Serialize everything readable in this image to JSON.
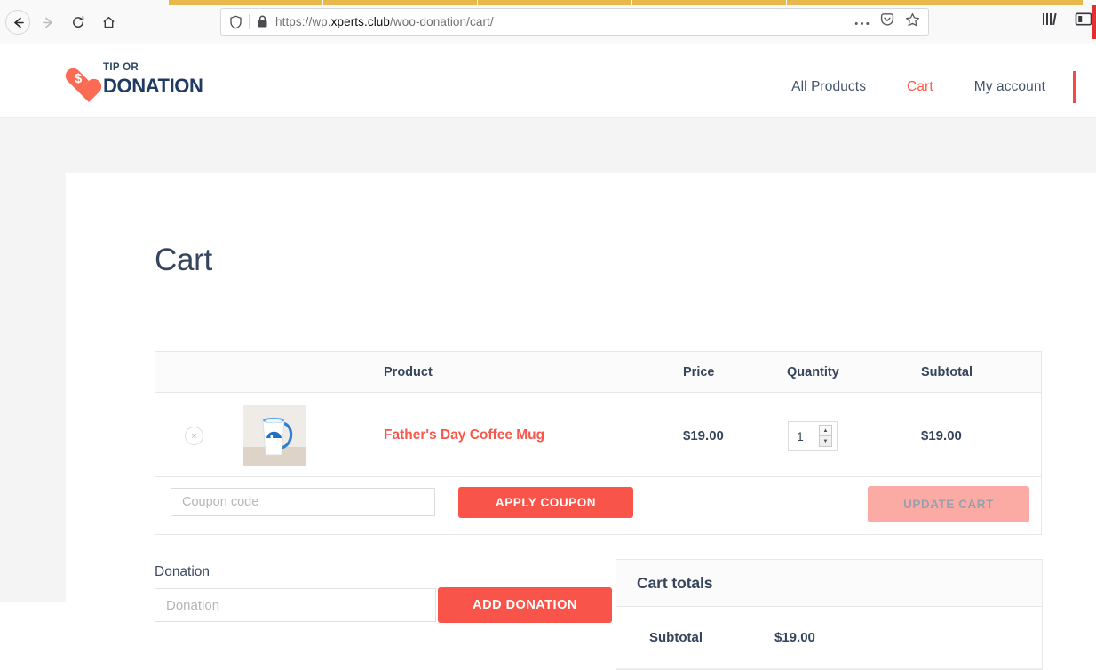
{
  "browser": {
    "tabs": [
      {
        "name": "tab-1"
      },
      {
        "name": "tab-2"
      },
      {
        "name": "tab-3"
      },
      {
        "name": "tab-4"
      },
      {
        "name": "tab-5"
      },
      {
        "name": "tab-6"
      }
    ],
    "back_icon": "back-arrow-icon",
    "forward_icon": "forward-arrow-icon",
    "reload_icon": "reload-icon",
    "home_icon": "home-icon",
    "shield_icon": "shield-icon",
    "lock_icon": "padlock-icon",
    "page_actions_icon": "ellipsis-icon",
    "pocket_icon": "pocket-save-icon",
    "bookmark_icon": "star-bookmark-icon",
    "library_icon": "library-icon",
    "sidebar_icon": "sidebar-toggle-icon",
    "url_prefix": "https://wp.",
    "url_domain": "xperts.club",
    "url_path": "/woo-donation/cart/",
    "url_full": "https://wp.xperts.club/woo-donation/cart/"
  },
  "site": {
    "logo": {
      "mark_symbol": "$",
      "tagline": "TIP OR",
      "name": "DONATION",
      "heart_color": "#fb6a52",
      "text_color": "#1f3a63"
    },
    "nav": {
      "items": [
        {
          "label": "All Products",
          "active": false
        },
        {
          "label": "Cart",
          "active": true
        },
        {
          "label": "My account",
          "active": false
        }
      ],
      "accent_color": "#f44a45"
    }
  },
  "page": {
    "title": "Cart"
  },
  "cart_table": {
    "headers": {
      "product": "Product",
      "price": "Price",
      "quantity": "Quantity",
      "subtotal": "Subtotal"
    },
    "rows": [
      {
        "remove_label": "×",
        "thumbnail": "coffee-mug-photo",
        "product_name": "Father's Day Coffee Mug",
        "price": "$19.00",
        "quantity": "1",
        "subtotal": "$19.00",
        "name_color": "#f9574b"
      }
    ],
    "coupon": {
      "placeholder": "Coupon code",
      "value": "",
      "apply_label": "APPLY COUPON",
      "apply_color": "#f9544a",
      "update_label": "UPDATE CART",
      "update_color": "#fbaba4",
      "update_text_color": "#9aa0ab",
      "update_disabled": true
    }
  },
  "donation": {
    "label": "Donation",
    "placeholder": "Donation",
    "value": "",
    "button_label": "ADD DONATION",
    "button_color": "#f9544a"
  },
  "cart_totals": {
    "title": "Cart totals",
    "rows": [
      {
        "label": "Subtotal",
        "value": "$19.00"
      }
    ]
  }
}
